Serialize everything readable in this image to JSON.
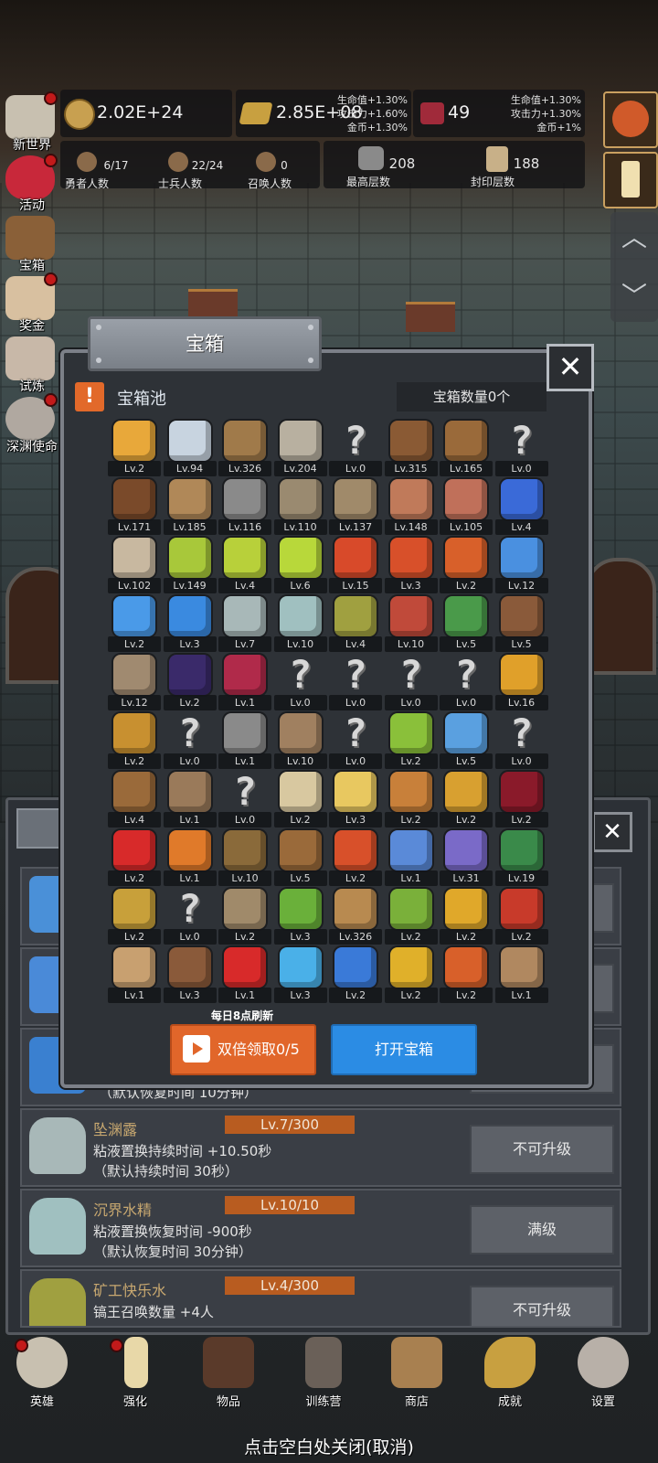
{
  "resources": {
    "gold": "2.02E+24",
    "gold_bonus": [
      "生命值+1.30%",
      "攻击力+1.60%",
      "金币+1.30%"
    ],
    "bars": "2.85E+08",
    "gems": "49",
    "gem_bonus": [
      "生命值+1.30%",
      "攻击力+1.30%",
      "金币+1%"
    ]
  },
  "stats": [
    {
      "value": "6/17",
      "label": "勇者人数"
    },
    {
      "value": "22/24",
      "label": "士兵人数"
    },
    {
      "value": "0",
      "label": "召唤人数"
    },
    {
      "value": "208",
      "label": "最高层数"
    },
    {
      "value": "188",
      "label": "封印层数"
    }
  ],
  "left_menu": [
    "新世界",
    "活动",
    "宝箱",
    "奖金",
    "试炼",
    "深渊使命"
  ],
  "modal": {
    "title": "宝箱",
    "pool_title": "宝箱池",
    "chest_count": "宝箱数量0个",
    "refresh_note": "每日8点刷新",
    "double_button": "双倍领取0/5",
    "open_button": "打开宝箱"
  },
  "items": [
    {
      "lv": "Lv.2",
      "icon": "crown-icon",
      "c": "#e8a83a"
    },
    {
      "lv": "Lv.94",
      "icon": "diamond-icon",
      "c": "#c8d4e0"
    },
    {
      "lv": "Lv.326",
      "icon": "sword-icon",
      "c": "#a07a4a"
    },
    {
      "lv": "Lv.204",
      "icon": "sword-icon",
      "c": "#b8b0a0"
    },
    {
      "lv": "Lv.0",
      "icon": "unknown-icon",
      "c": ""
    },
    {
      "lv": "Lv.315",
      "icon": "leather-armor-icon",
      "c": "#8a5a34"
    },
    {
      "lv": "Lv.165",
      "icon": "leather-armor-icon",
      "c": "#9a6a3a"
    },
    {
      "lv": "Lv.0",
      "icon": "unknown-icon",
      "c": ""
    },
    {
      "lv": "Lv.171",
      "icon": "leather-helmet-icon",
      "c": "#7a4a2a"
    },
    {
      "lv": "Lv.185",
      "icon": "sword-icon",
      "c": "#b08858"
    },
    {
      "lv": "Lv.116",
      "icon": "knight-helmet-icon",
      "c": "#8a8a8a"
    },
    {
      "lv": "Lv.110",
      "icon": "hammer-icon",
      "c": "#9a8a70"
    },
    {
      "lv": "Lv.137",
      "icon": "great-helm-icon",
      "c": "#a08a6a"
    },
    {
      "lv": "Lv.148",
      "icon": "meat-icon",
      "c": "#c07a5a"
    },
    {
      "lv": "Lv.105",
      "icon": "steak-icon",
      "c": "#c0705a"
    },
    {
      "lv": "Lv.4",
      "icon": "pouch-icon",
      "c": "#3a6ad8"
    },
    {
      "lv": "Lv.102",
      "icon": "bread-icon",
      "c": "#c8b8a0"
    },
    {
      "lv": "Lv.149",
      "icon": "potion-icon",
      "c": "#a8c83a"
    },
    {
      "lv": "Lv.4",
      "icon": "potion-icon",
      "c": "#b8d03a"
    },
    {
      "lv": "Lv.6",
      "icon": "potion-icon",
      "c": "#b8d83a"
    },
    {
      "lv": "Lv.15",
      "icon": "potion-icon",
      "c": "#d84a2a"
    },
    {
      "lv": "Lv.3",
      "icon": "potion-icon",
      "c": "#d8502a"
    },
    {
      "lv": "Lv.2",
      "icon": "potion-icon",
      "c": "#d8602a"
    },
    {
      "lv": "Lv.12",
      "icon": "potion-icon",
      "c": "#4a90e0"
    },
    {
      "lv": "Lv.2",
      "icon": "potion-icon",
      "c": "#4a9ae8"
    },
    {
      "lv": "Lv.3",
      "icon": "potion-icon",
      "c": "#3a8ae0"
    },
    {
      "lv": "Lv.7",
      "icon": "bottle-icon",
      "c": "#a8b8b8"
    },
    {
      "lv": "Lv.10",
      "icon": "bottle-icon",
      "c": "#a0c0c0"
    },
    {
      "lv": "Lv.4",
      "icon": "bottle-icon",
      "c": "#a0a040"
    },
    {
      "lv": "Lv.10",
      "icon": "bottle-icon",
      "c": "#c04a3a"
    },
    {
      "lv": "Lv.5",
      "icon": "winged-boot-icon",
      "c": "#4a9a4a"
    },
    {
      "lv": "Lv.5",
      "icon": "boot-icon",
      "c": "#8a5a3a"
    },
    {
      "lv": "Lv.12",
      "icon": "boot-icon",
      "c": "#a08a70"
    },
    {
      "lv": "Lv.2",
      "icon": "boot-icon",
      "c": "#3a2a6a"
    },
    {
      "lv": "Lv.1",
      "icon": "boot-icon",
      "c": "#b02a4a"
    },
    {
      "lv": "Lv.0",
      "icon": "unknown-icon",
      "c": ""
    },
    {
      "lv": "Lv.0",
      "icon": "unknown-icon",
      "c": ""
    },
    {
      "lv": "Lv.0",
      "icon": "unknown-icon",
      "c": ""
    },
    {
      "lv": "Lv.0",
      "icon": "unknown-icon",
      "c": ""
    },
    {
      "lv": "Lv.16",
      "icon": "torch-icon",
      "c": "#e0a02a"
    },
    {
      "lv": "Lv.2",
      "icon": "torch-icon",
      "c": "#c89030"
    },
    {
      "lv": "Lv.0",
      "icon": "unknown-icon",
      "c": ""
    },
    {
      "lv": "Lv.1",
      "icon": "pickaxe-icon",
      "c": "#8a8a8a"
    },
    {
      "lv": "Lv.10",
      "icon": "staff-icon",
      "c": "#a08060"
    },
    {
      "lv": "Lv.0",
      "icon": "unknown-icon",
      "c": ""
    },
    {
      "lv": "Lv.2",
      "icon": "lime-icon",
      "c": "#8ac03a"
    },
    {
      "lv": "Lv.5",
      "icon": "wand-icon",
      "c": "#5aa0e0"
    },
    {
      "lv": "Lv.0",
      "icon": "unknown-icon",
      "c": ""
    },
    {
      "lv": "Lv.4",
      "icon": "backpack-icon",
      "c": "#9a6a3a"
    },
    {
      "lv": "Lv.1",
      "icon": "shovel-icon",
      "c": "#9a7a5a"
    },
    {
      "lv": "Lv.0",
      "icon": "unknown-icon",
      "c": ""
    },
    {
      "lv": "Lv.2",
      "icon": "bone-club-icon",
      "c": "#d8c8a0"
    },
    {
      "lv": "Lv.3",
      "icon": "cheese-icon",
      "c": "#e8c860"
    },
    {
      "lv": "Lv.2",
      "icon": "pie-icon",
      "c": "#c8803a"
    },
    {
      "lv": "Lv.2",
      "icon": "jar-icon",
      "c": "#d8a030"
    },
    {
      "lv": "Lv.2",
      "icon": "dark-crystal-icon",
      "c": "#8a1a2a"
    },
    {
      "lv": "Lv.2",
      "icon": "red-orb-icon",
      "c": "#d82a2a"
    },
    {
      "lv": "Lv.1",
      "icon": "rainbow-orb-icon",
      "c": "#e07a2a"
    },
    {
      "lv": "Lv.10",
      "icon": "bow-icon",
      "c": "#8a6a3a"
    },
    {
      "lv": "Lv.5",
      "icon": "quiver-icon",
      "c": "#9a6a3a"
    },
    {
      "lv": "Lv.2",
      "icon": "fire-gauntlet-icon",
      "c": "#d8502a"
    },
    {
      "lv": "Lv.1",
      "icon": "blue-gauntlet-icon",
      "c": "#5a8ad8"
    },
    {
      "lv": "Lv.31",
      "icon": "purple-beast-icon",
      "c": "#7a6ac8"
    },
    {
      "lv": "Lv.19",
      "icon": "shield-emblem-icon",
      "c": "#3a8a4a"
    },
    {
      "lv": "Lv.2",
      "icon": "lantern-icon",
      "c": "#c8a03a"
    },
    {
      "lv": "Lv.0",
      "icon": "unknown-icon",
      "c": ""
    },
    {
      "lv": "Lv.2",
      "icon": "arrow-icon",
      "c": "#a08a6a"
    },
    {
      "lv": "Lv.3",
      "icon": "green-wand-icon",
      "c": "#6ab03a"
    },
    {
      "lv": "Lv.326",
      "icon": "beer-mug-icon",
      "c": "#b88a50"
    },
    {
      "lv": "Lv.2",
      "icon": "vine-icon",
      "c": "#7ab03a"
    },
    {
      "lv": "Lv.2",
      "icon": "golden-pickaxe-icon",
      "c": "#e0a82a"
    },
    {
      "lv": "Lv.2",
      "icon": "red-book-icon",
      "c": "#c83a2a"
    },
    {
      "lv": "Lv.1",
      "icon": "scroll-icon",
      "c": "#c8a070"
    },
    {
      "lv": "Lv.3",
      "icon": "whip-icon",
      "c": "#8a5a3a"
    },
    {
      "lv": "Lv.1",
      "icon": "red-card-icon",
      "c": "#d82a2a"
    },
    {
      "lv": "Lv.3",
      "icon": "blue-pedestal-icon",
      "c": "#4ab0e8"
    },
    {
      "lv": "Lv.2",
      "icon": "blue-rune-icon",
      "c": "#3a7ad8"
    },
    {
      "lv": "Lv.2",
      "icon": "golden-orb-icon",
      "c": "#e0b02a"
    },
    {
      "lv": "Lv.2",
      "icon": "fire-wrench-icon",
      "c": "#d8602a"
    },
    {
      "lv": "Lv.1",
      "icon": "wooden-mask-icon",
      "c": "#b08860"
    }
  ],
  "under_rows": [
    {
      "name": "",
      "level": "",
      "desc1": "",
      "desc2": "",
      "btn": "",
      "icon_color": "#4a90d8"
    },
    {
      "name": "",
      "level": "",
      "desc1": "",
      "desc2": "",
      "btn": "",
      "icon_color": "#4a8ad8"
    },
    {
      "name": "",
      "level": "",
      "desc1": "",
      "desc2": "（默认恢复时间 10分钟）",
      "btn": "",
      "icon_color": "#3a80d0"
    },
    {
      "name": "坠渊露",
      "level": "Lv.7/300",
      "desc1": "粘液置换持续时间 +10.50秒",
      "desc2": "（默认持续时间 30秒）",
      "btn": "不可升级",
      "icon_color": "#a8b8b8"
    },
    {
      "name": "沉界水精",
      "level": "Lv.10/10",
      "desc1": "粘液置换恢复时间 -900秒",
      "desc2": "（默认恢复时间 30分钟）",
      "btn": "满级",
      "icon_color": "#a0c0c0"
    },
    {
      "name": "矿工快乐水",
      "level": "Lv.4/300",
      "desc1": "镐王召唤数量 +4人",
      "desc2": "",
      "btn": "不可升级",
      "icon_color": "#a0a040"
    }
  ],
  "nav": [
    "英雄",
    "强化",
    "物品",
    "训练营",
    "商店",
    "成就",
    "设置"
  ],
  "close_hint": "点击空白处关闭(取消)",
  "colors": {
    "orange": "#e1662a",
    "blue": "#2b8ce4",
    "panel": "#2e3237"
  }
}
